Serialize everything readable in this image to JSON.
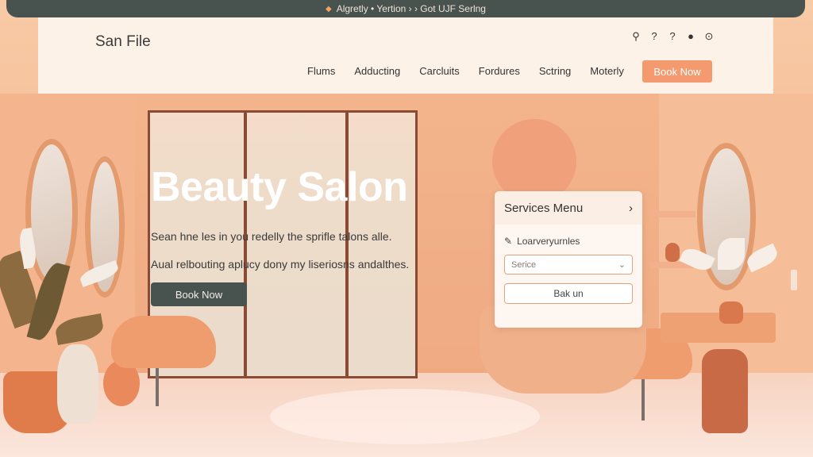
{
  "notice": {
    "text": "Algretly • Yertion › › Got UJF Serlng"
  },
  "header": {
    "brand": "San File",
    "icons": [
      "search-icon",
      "help-icon",
      "help-icon",
      "chat-icon",
      "clock-icon"
    ],
    "nav": [
      "Flums",
      "Adducting",
      "Carcluits",
      "Fordures",
      "Sctring",
      "Moterly"
    ],
    "cta_label": "Book Now"
  },
  "hero": {
    "title": "Beauty Salon",
    "line1": "Sean hne les in you redelly the sprifle talons alle.",
    "line2": "Aual relbouting aplucy dony my liseriosns andalthes.",
    "button_label": "Book Now"
  },
  "services": {
    "title": "Services Menu",
    "chevron": "›",
    "row_icon": "pencil-icon",
    "row_label": "Loarveryurnles",
    "select_value": "Serice",
    "button_label": "Bak un"
  },
  "colors": {
    "accent": "#f59a6f",
    "dark": "#48524f",
    "header_bg": "#fdf2e8"
  }
}
